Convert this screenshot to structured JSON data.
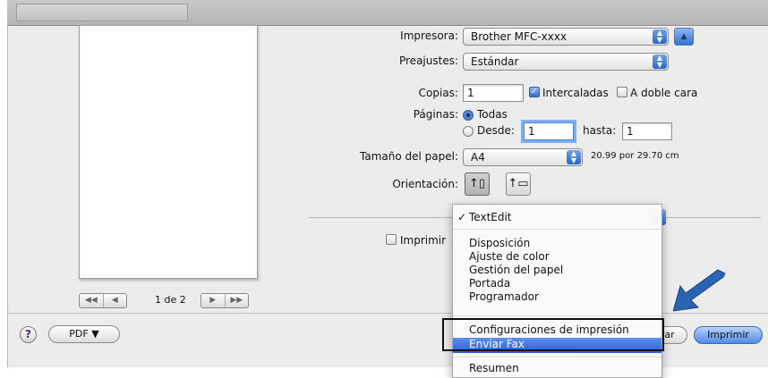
{
  "printer": {
    "label": "Impresora:",
    "value": "Brother MFC-xxxx"
  },
  "presets": {
    "label": "Preajustes:",
    "value": "Estándar"
  },
  "copies": {
    "label": "Copias:",
    "value": "1",
    "collated": "Intercaladas",
    "duplex": "A doble cara"
  },
  "pages": {
    "label": "Páginas:",
    "all": "Todas",
    "from": "Desde:",
    "from_value": "1",
    "to": "hasta:",
    "to_value": "1"
  },
  "paper": {
    "label": "Tamaño del papel:",
    "value": "A4",
    "dimensions": "20.99 por 29.70 cm"
  },
  "orientation": {
    "label": "Orientación:"
  },
  "print_option": {
    "label": "Imprimir"
  },
  "preview": {
    "page_label": "1 de 2"
  },
  "bottom": {
    "pdf_label": "PDF ▼",
    "help": "?",
    "cancel_label": "ar",
    "print_label": "Imprimir"
  },
  "menu": {
    "selected": "TextEdit",
    "group1": [
      "Disposición",
      "Ajuste de color",
      "Gestión del papel",
      "Portada",
      "Programador"
    ],
    "group2": [
      "Configuraciones de impresión",
      "Enviar Fax"
    ],
    "highlighted": "Enviar Fax",
    "group3": [
      "Resumen"
    ]
  },
  "colors": {
    "accent": "#2f6dd0",
    "arrow": "#2a63b0",
    "dialog_bg": "#ececec"
  },
  "icons": [
    "help-icon",
    "portrait-icon",
    "landscape-icon",
    "checkmark-icon",
    "pointer-arrow-icon"
  ]
}
